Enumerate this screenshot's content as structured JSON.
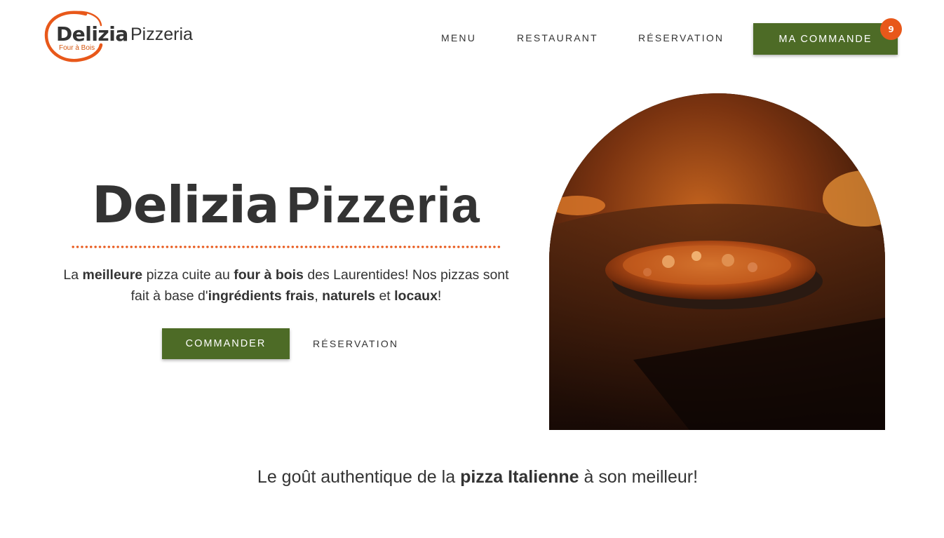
{
  "logo": {
    "name_bold": "Delizia",
    "name_light": "Pizzeria",
    "subtitle": "Four à Bois"
  },
  "nav": {
    "items": [
      {
        "label": "MENU"
      },
      {
        "label": "RESTAURANT"
      },
      {
        "label": "RÉSERVATION"
      }
    ],
    "order_button": "MA COMMANDE",
    "order_count": "9"
  },
  "hero": {
    "title_bold": "Delizia",
    "title_light": "Pizzeria",
    "description": {
      "p1": "La ",
      "b1": "meilleure",
      "p2": " pizza cuite au ",
      "b2": "four à bois",
      "p3": " des Laurentides! Nos pizzas sont fait à base d'",
      "b3": "ingrédients frais",
      "p4": ", ",
      "b4": "naturels",
      "p5": " et ",
      "b5": "locaux",
      "p6": "!"
    },
    "cta_primary": "COMMANDER",
    "cta_secondary": "RÉSERVATION"
  },
  "tagline": {
    "p1": "Le goût authentique de la ",
    "b1": "pizza Italienne",
    "p2": " à son meilleur!"
  },
  "colors": {
    "brand_green": "#4d6b26",
    "accent_orange": "#e8581a",
    "text_dark": "#333333"
  },
  "icons": {
    "logo_swirl": "logo-swirl-icon"
  }
}
